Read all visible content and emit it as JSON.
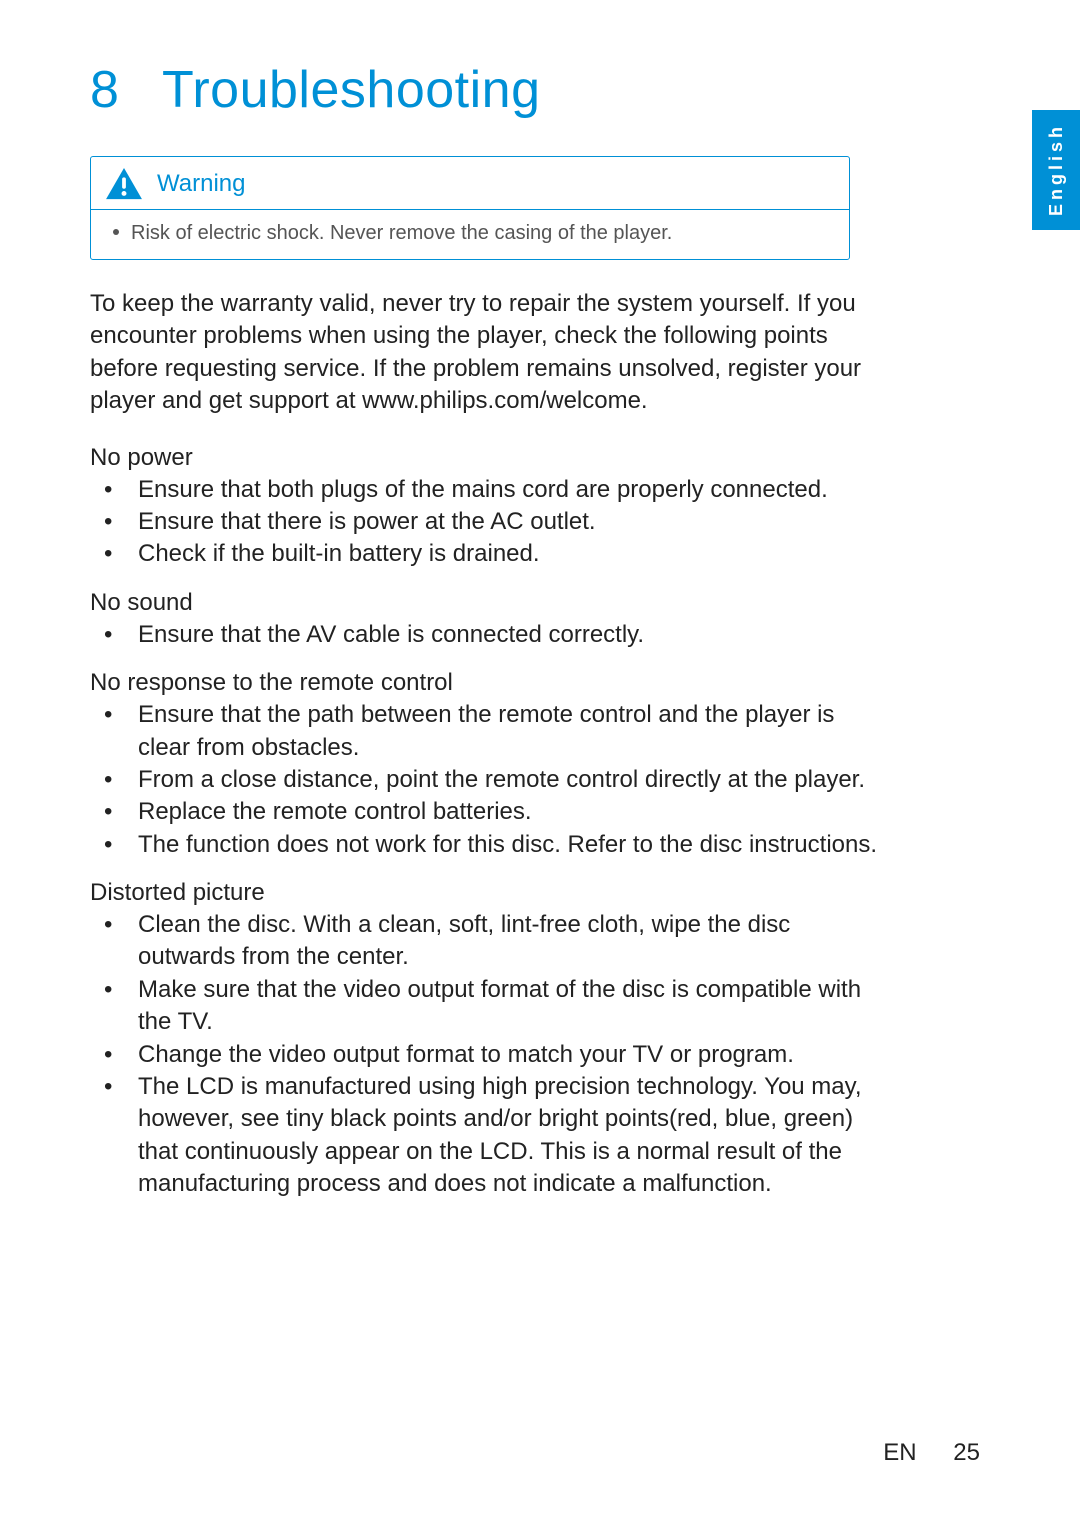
{
  "langTab": "English",
  "chapter": {
    "number": "8",
    "title": "Troubleshooting"
  },
  "warning": {
    "title": "Warning",
    "text": "Risk of electric shock. Never remove the casing of the player."
  },
  "intro": "To keep the warranty valid, never try to repair the system yourself. If you encounter problems when using the player, check the following points before requesting service. If the problem remains unsolved, register your player and get support at www.philips.com/welcome.",
  "sections": {
    "noPower": {
      "head": "No power",
      "items": [
        "Ensure that both plugs of the mains cord are properly connected.",
        "Ensure that there is power at the AC outlet.",
        "Check if the built-in battery is drained."
      ]
    },
    "noSound": {
      "head": "No sound",
      "items": [
        "Ensure that the AV cable is connected correctly."
      ]
    },
    "noRemote": {
      "head": "No response to the remote control",
      "items": [
        "Ensure that the path between the remote control and the player is clear from obstacles.",
        "From a close distance, point the remote control directly at the player.",
        "Replace the remote control batteries.",
        "The function does not work for this disc. Refer to the disc instructions."
      ]
    },
    "distorted": {
      "head": "Distorted picture",
      "items": [
        "Clean the disc. With a clean, soft, lint-free cloth, wipe the disc outwards from the center.",
        "Make sure that the video output format of the disc is compatible with the TV.",
        "Change the video output format to match your TV or program.",
        "The LCD is manufactured using high precision technology. You may, however, see tiny black points and/or bright points(red, blue, green) that continuously appear on the LCD. This is a normal result of the manufacturing process and does not indicate a malfunction."
      ]
    }
  },
  "footer": {
    "lang": "EN",
    "page": "25"
  }
}
